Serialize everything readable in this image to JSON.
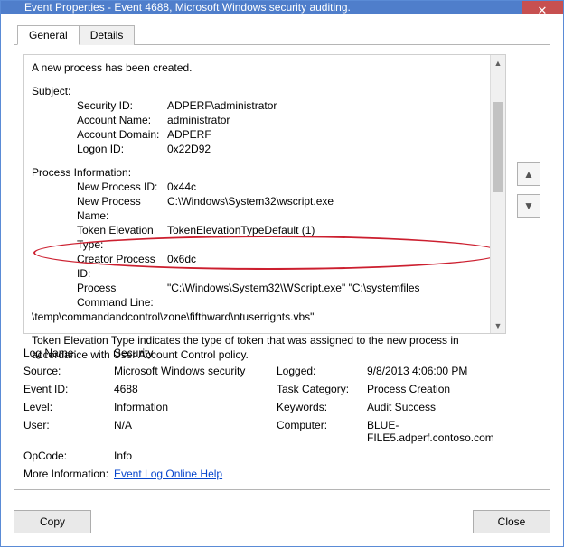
{
  "window": {
    "title": "Event Properties - Event 4688, Microsoft Windows security auditing."
  },
  "tabs": {
    "general": "General",
    "details": "Details"
  },
  "message": {
    "title": "A new process has been created.",
    "subject_heading": "Subject:",
    "subject": {
      "security_id_label": "Security ID:",
      "security_id": "ADPERF\\administrator",
      "account_name_label": "Account Name:",
      "account_name": "administrator",
      "account_domain_label": "Account Domain:",
      "account_domain": "ADPERF",
      "logon_id_label": "Logon ID:",
      "logon_id": "0x22D92"
    },
    "process_heading": "Process Information:",
    "process": {
      "new_pid_label": "New Process ID:",
      "new_pid": "0x44c",
      "new_pname_label": "New Process Name:",
      "new_pname": "C:\\Windows\\System32\\wscript.exe",
      "token_elev_label": "Token Elevation Type:",
      "token_elev": "TokenElevationTypeDefault (1)",
      "creator_pid_label": "Creator Process ID:",
      "creator_pid": "0x6dc",
      "cmdline_label": "Process Command Line:",
      "cmdline_part1": "\"C:\\Windows\\System32\\WScript.exe\" \"C:\\systemfiles",
      "cmdline_part2": "\\temp\\commandandcontrol\\zone\\fifthward\\ntuserrights.vbs\""
    },
    "footer": "Token Elevation Type indicates the type of token that was assigned to the new process in accordance with User Account Control policy."
  },
  "meta": {
    "logname_label": "Log Name:",
    "logname": "Security",
    "source_label": "Source:",
    "source": "Microsoft Windows security",
    "logged_label": "Logged:",
    "logged": "9/8/2013 4:06:00 PM",
    "eventid_label": "Event ID:",
    "eventid": "4688",
    "taskcat_label": "Task Category:",
    "taskcat": "Process Creation",
    "level_label": "Level:",
    "level": "Information",
    "keywords_label": "Keywords:",
    "keywords": "Audit Success",
    "user_label": "User:",
    "user": "N/A",
    "computer_label": "Computer:",
    "computer": "BLUE-FILE5.adperf.contoso.com",
    "opcode_label": "OpCode:",
    "opcode": "Info",
    "moreinfo_label": "More Information:",
    "moreinfo_link": "Event Log Online Help"
  },
  "buttons": {
    "copy": "Copy",
    "close": "Close"
  }
}
